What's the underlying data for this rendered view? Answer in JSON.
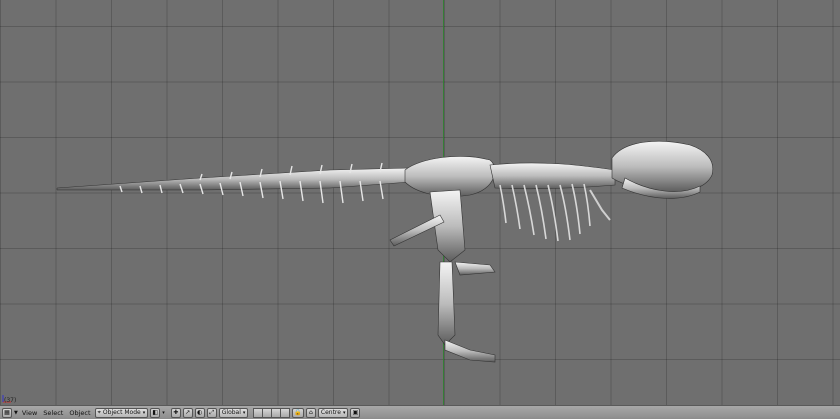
{
  "viewport": {
    "frame_label": "(37)",
    "grid_color": "#5f5f5f",
    "axis_color": "#2f7f2f"
  },
  "header": {
    "menus": {
      "view": "View",
      "select": "Select",
      "object": "Object"
    },
    "mode_dropdown": "Object Mode",
    "pivot_dropdown": "Global",
    "snap_dropdown": "Centre",
    "icons": [
      "editor-type-icon",
      "mode-icon",
      "draw-type-icon",
      "pivot-icon",
      "manipulator-icon",
      "layer-buttons",
      "lock-icon",
      "render-icon"
    ]
  }
}
